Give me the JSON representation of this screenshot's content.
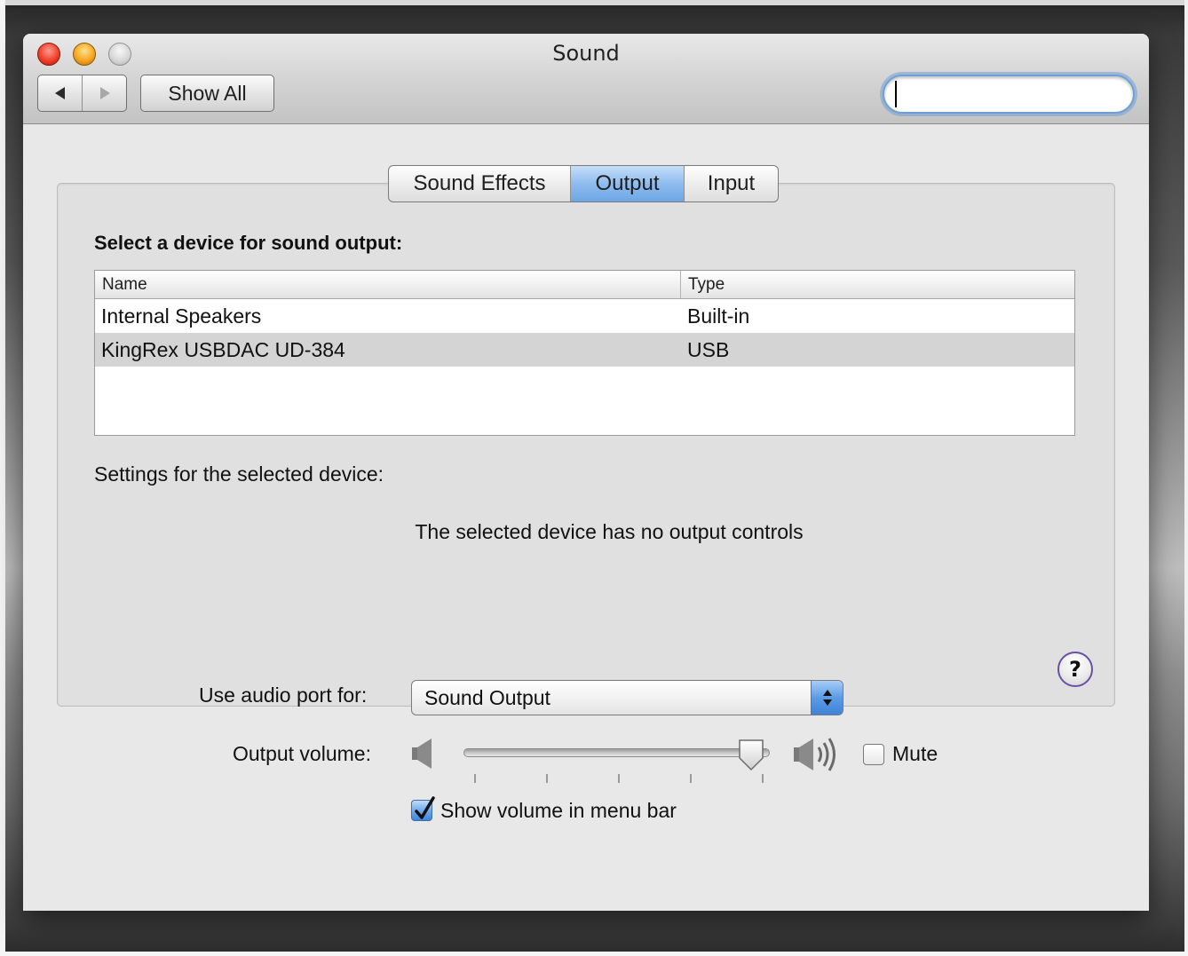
{
  "window": {
    "title": "Sound",
    "show_all_label": "Show All"
  },
  "toolbar": {
    "back_icon": "back-arrow-icon",
    "forward_icon": "forward-arrow-icon",
    "search": {
      "value": "",
      "placeholder": ""
    }
  },
  "tabs": [
    {
      "label": "Sound Effects",
      "selected": false
    },
    {
      "label": "Output",
      "selected": true
    },
    {
      "label": "Input",
      "selected": false
    }
  ],
  "output": {
    "heading": "Select a device for sound output:",
    "columns": [
      "Name",
      "Type"
    ],
    "devices": [
      {
        "name": "Internal Speakers",
        "type": "Built-in",
        "selected": false
      },
      {
        "name": "KingRex USBDAC UD-384",
        "type": "USB",
        "selected": true
      }
    ],
    "settings_label": "Settings for the selected device:",
    "no_controls_message": "The selected device has no output controls",
    "help_label": "?"
  },
  "footer": {
    "audio_port_label": "Use audio port for:",
    "audio_port_value": "Sound Output",
    "volume_label": "Output volume:",
    "volume_level": 0.94,
    "mute_label": "Mute",
    "mute_checked": false,
    "menu_bar_label": "Show volume in menu bar",
    "menu_bar_checked": true
  },
  "colors": {
    "selected_tab": "#8fbcef",
    "selected_row": "#d4d4d4",
    "search_focus": "#6f9fd6",
    "checkbox_checked": "#5b9be5"
  }
}
